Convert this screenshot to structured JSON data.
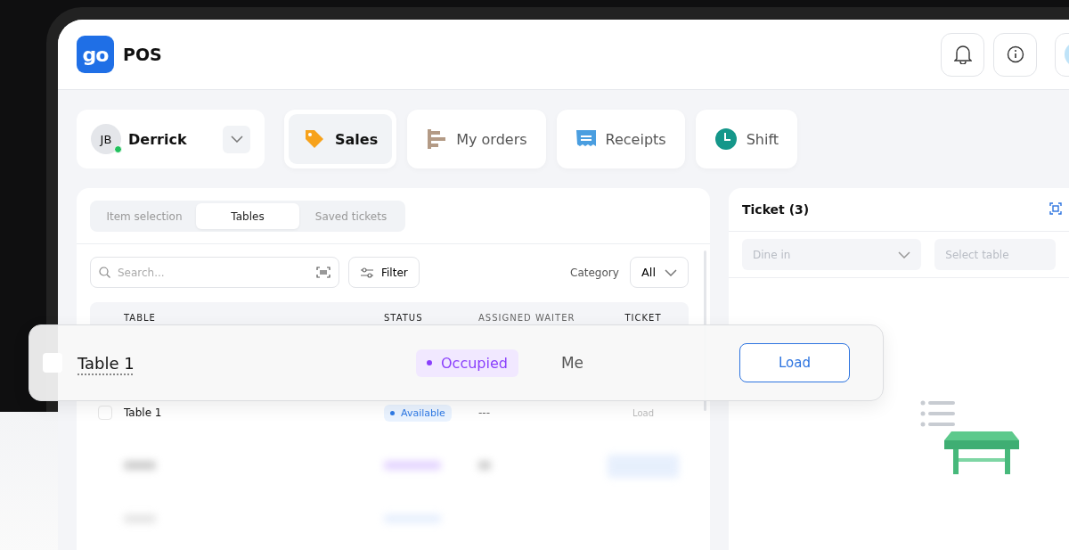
{
  "app": {
    "logo_text": "go",
    "title": "POS"
  },
  "user": {
    "initials": "JB",
    "name": "Derrick",
    "online": true
  },
  "nav": [
    {
      "label": "Sales",
      "kind": "tag",
      "selected": true
    },
    {
      "label": "My orders",
      "kind": "orders",
      "selected": false
    },
    {
      "label": "Receipts",
      "kind": "receipt",
      "selected": false
    },
    {
      "label": "Shift",
      "kind": "clock",
      "selected": false
    }
  ],
  "tabs": [
    {
      "label": "Item selection",
      "selected": false
    },
    {
      "label": "Tables",
      "selected": true
    },
    {
      "label": "Saved tickets",
      "selected": false
    }
  ],
  "search": {
    "placeholder": "Search..."
  },
  "filter_button": "Filter",
  "category": {
    "label": "Category",
    "value": "All"
  },
  "table": {
    "columns": [
      "TABLE",
      "STATUS",
      "ASSIGNED WAITER",
      "TICKET"
    ],
    "rows": [
      {
        "table": "Table 1",
        "status": "Available",
        "kind": "available",
        "waiter": "---",
        "action": "Load",
        "checked": false
      }
    ]
  },
  "highlighted_row": {
    "table": "Table 1",
    "status": "Occupied",
    "kind": "occupied",
    "waiter": "Me",
    "action": "Load",
    "checked": false
  },
  "ticket": {
    "title": "Ticket (3)",
    "order_type": "Dine in",
    "table_placeholder": "Select table"
  }
}
